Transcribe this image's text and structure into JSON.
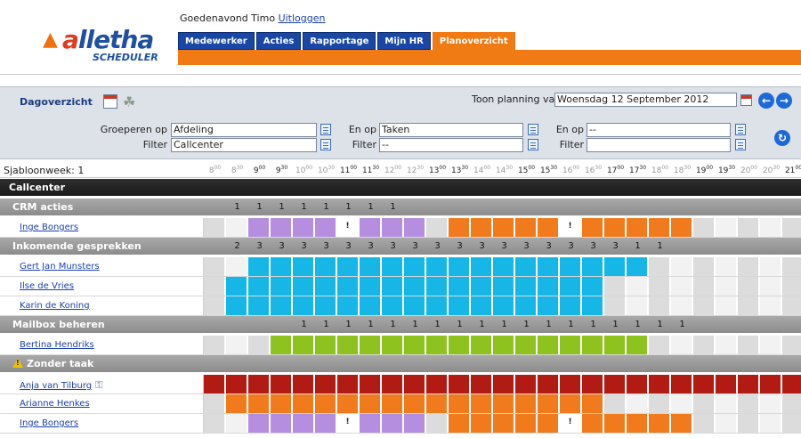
{
  "header": {
    "greeting": "Goedenavond Timo",
    "logout": "Uitloggen",
    "logo_text": "allETHA",
    "logo_sub": "SCHEDULER",
    "tabs": [
      {
        "label": "Medewerker"
      },
      {
        "label": "Acties"
      },
      {
        "label": "Rapportage"
      },
      {
        "label": "Mijn HR"
      },
      {
        "label": "Planoverzicht",
        "active": true
      }
    ]
  },
  "toolbar": {
    "title": "Dagoverzicht",
    "toon_label": "Toon planning van",
    "date_value": "Woensdag 12 September 2012",
    "group_label": "Groeperen op",
    "group_value": "Afdeling",
    "filter_label": "Filter",
    "filter_value": "Callcenter",
    "en_op_label": "En op",
    "en_op_value": "Taken",
    "filter2_value": "--",
    "en_op2_value": "--",
    "filter3_value": ""
  },
  "schedule": {
    "week_label": "Sjabloonweek: 1",
    "hours": [
      {
        "h": "8",
        "m": "00",
        "dim": true
      },
      {
        "h": "8",
        "m": "30",
        "dim": true
      },
      {
        "h": "9",
        "m": "00",
        "dim": false
      },
      {
        "h": "9",
        "m": "30",
        "dim": false
      },
      {
        "h": "10",
        "m": "00",
        "dim": true
      },
      {
        "h": "10",
        "m": "30",
        "dim": true
      },
      {
        "h": "11",
        "m": "00",
        "dim": false
      },
      {
        "h": "11",
        "m": "30",
        "dim": false
      },
      {
        "h": "12",
        "m": "00",
        "dim": true
      },
      {
        "h": "12",
        "m": "30",
        "dim": true
      },
      {
        "h": "13",
        "m": "00",
        "dim": false
      },
      {
        "h": "13",
        "m": "30",
        "dim": false
      },
      {
        "h": "14",
        "m": "00",
        "dim": true
      },
      {
        "h": "14",
        "m": "30",
        "dim": true
      },
      {
        "h": "15",
        "m": "00",
        "dim": false
      },
      {
        "h": "15",
        "m": "30",
        "dim": false
      },
      {
        "h": "16",
        "m": "00",
        "dim": true
      },
      {
        "h": "16",
        "m": "30",
        "dim": true
      },
      {
        "h": "17",
        "m": "00",
        "dim": false
      },
      {
        "h": "17",
        "m": "30",
        "dim": false
      },
      {
        "h": "18",
        "m": "00",
        "dim": true
      },
      {
        "h": "18",
        "m": "30",
        "dim": true
      },
      {
        "h": "19",
        "m": "00",
        "dim": false
      },
      {
        "h": "19",
        "m": "30",
        "dim": false
      },
      {
        "h": "20",
        "m": "00",
        "dim": true
      },
      {
        "h": "20",
        "m": "30",
        "dim": true
      },
      {
        "h": "21",
        "m": "00",
        "dim": false
      }
    ],
    "colors": {
      "purple": "#b68ee0",
      "orange": "#f07a1c",
      "cyan": "#16b6e6",
      "green": "#8ec21e",
      "red": "#b21a14",
      "gray": "#dcdcdc",
      "white": "#ffffff",
      "off": "#f2f2f2"
    },
    "rows": [
      {
        "type": "dept",
        "label": "Callcenter"
      },
      {
        "type": "group",
        "label": "CRM acties",
        "counts": [
          "1",
          "1",
          "1",
          "1",
          "1",
          "1",
          "1",
          "1",
          ""
        ]
      },
      {
        "type": "person",
        "label": "Inge Bongers",
        "slots": "ggPPPPMPPPgOOOOOMOOOOOgggggggg"
      },
      {
        "type": "group",
        "label": "Inkomende gesprekken",
        "counts": [
          "2",
          "3",
          "3",
          "3",
          "3",
          "3",
          "3",
          "3",
          "3",
          "3",
          "3",
          "3",
          "3",
          "3",
          "3",
          "3",
          "3",
          "3",
          "1",
          "1"
        ]
      },
      {
        "type": "person",
        "label": "Gert Jan Munsters",
        "slots": "ggCCCCCCCCCCCCCCCCCCgggggggggg"
      },
      {
        "type": "person",
        "label": "Ilse de Vries",
        "slots": "gCCCCCCCCCCCCCCCCCggggggggggggg"
      },
      {
        "type": "person",
        "label": "Karin de Koning",
        "slots": "gCCCCCCCCCCCCCCCCCggggggggggggg"
      },
      {
        "type": "group",
        "label": "Mailbox beheren",
        "counts": [
          "1",
          "1",
          "1",
          "1",
          "1",
          "1",
          "1",
          "1",
          "1",
          "1",
          "1",
          "1",
          "1",
          "1",
          "1",
          "1",
          "1",
          "1"
        ]
      },
      {
        "type": "person",
        "label": "Bertina Hendriks",
        "slots": "gggGGGGGGGGGGGGGGGGGgggggggggg"
      },
      {
        "type": "group",
        "label": "Zonder taak",
        "warn": true,
        "counts": []
      },
      {
        "type": "person",
        "label": "Anja van Tilburg",
        "key": true,
        "slots": "RRRRRRRRRRRRRRRRRRRRRRRRRRRRRR"
      },
      {
        "type": "person",
        "label": "Arianne Henkes",
        "slots": "gOOOOOOOOOOOOOOOOOggggggggggggg"
      },
      {
        "type": "person",
        "label": "Inge Bongers",
        "slots": "ggPPPPMPPPgOOOOOMOOOOOgggggggg"
      }
    ]
  }
}
